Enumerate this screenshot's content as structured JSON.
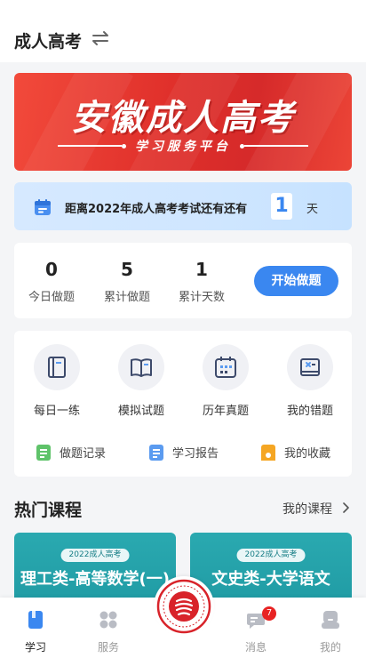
{
  "header": {
    "title": "成人高考"
  },
  "banner": {
    "title": "安徽成人高考",
    "subtitle": "学习服务平台"
  },
  "countdown": {
    "text": "距离2022年成人高考考试还有还有",
    "days": "1",
    "unit": "天"
  },
  "stats": {
    "items": [
      {
        "value": "0",
        "label": "今日做题"
      },
      {
        "value": "5",
        "label": "累计做题"
      },
      {
        "value": "1",
        "label": "累计天数"
      }
    ],
    "start_label": "开始做题"
  },
  "menu": {
    "items": [
      {
        "label": "每日一练",
        "icon": "notebook-icon"
      },
      {
        "label": "模拟试题",
        "icon": "open-book-icon"
      },
      {
        "label": "历年真题",
        "icon": "calendar-icon"
      },
      {
        "label": "我的错题",
        "icon": "wrong-answer-icon"
      }
    ],
    "sub_items": [
      {
        "label": "做题记录",
        "icon": "record-icon",
        "color": "#5fc36a"
      },
      {
        "label": "学习报告",
        "icon": "report-icon",
        "color": "#5b9bf0"
      },
      {
        "label": "我的收藏",
        "icon": "bookmark-icon",
        "color": "#f5a623"
      }
    ]
  },
  "courses": {
    "title": "热门课程",
    "my_courses": "我的课程",
    "items": [
      {
        "tag": "2022成人高考",
        "name": "理工类-高等数学(一)"
      },
      {
        "tag": "2022成人高考",
        "name": "文史类-大学语文"
      }
    ]
  },
  "tabbar": {
    "items": [
      {
        "label": "学习",
        "active": true
      },
      {
        "label": "服务",
        "active": false
      },
      {
        "label": "消息",
        "active": false,
        "badge": "7"
      },
      {
        "label": "我的",
        "active": false
      }
    ]
  },
  "colors": {
    "accent": "#3a87f0",
    "banner_red": "#e0302b",
    "badge": "#e82323",
    "course_teal": "#2aa9b0"
  }
}
